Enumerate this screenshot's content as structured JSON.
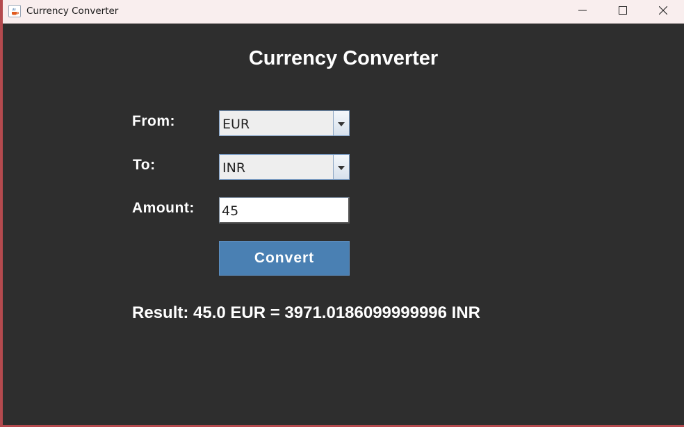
{
  "window": {
    "title": "Currency Converter"
  },
  "heading": "Currency Converter",
  "form": {
    "from_label": "From:",
    "from_value": "EUR",
    "to_label": "To:",
    "to_value": "INR",
    "amount_label": "Amount:",
    "amount_value": "45",
    "convert_label": "Convert"
  },
  "result": "Result: 45.0 EUR = 3971.0186099999996 INR",
  "icons": {
    "app": "java-cup-icon",
    "minimize": "minimize-icon",
    "maximize": "maximize-icon",
    "close": "close-icon",
    "dropdown": "chevron-down-icon"
  },
  "colors": {
    "background": "#2e2e2e",
    "titlebar": "#f9eeee",
    "button": "#4a80b3",
    "text": "#ffffff"
  }
}
